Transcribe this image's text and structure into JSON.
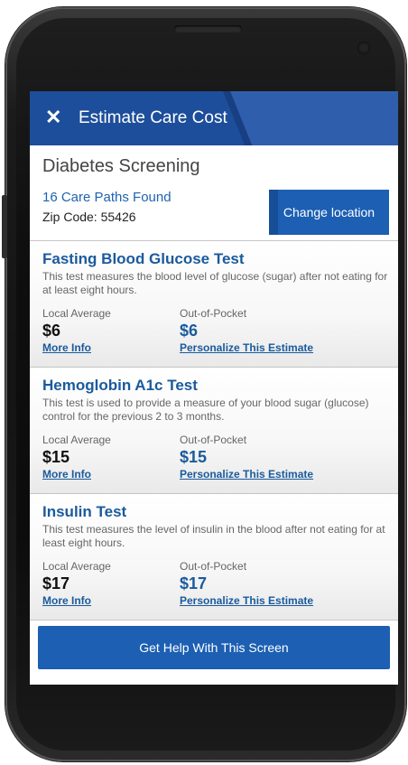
{
  "header": {
    "close_icon": "✕",
    "title": "Estimate Care Cost"
  },
  "page_title": "Diabetes Screening",
  "results": {
    "count_text": "16 Care Paths Found",
    "zip_text": "Zip Code: 55426",
    "change_location_label": "Change location"
  },
  "tests": [
    {
      "name": "Fasting Blood Glucose Test",
      "description": "This test measures the blood level of glucose (sugar) after not eating for at least eight hours.",
      "local_label": "Local Average",
      "local_value": "$6",
      "oop_label": "Out-of-Pocket",
      "oop_value": "$6",
      "more_info": "More Info",
      "personalize": "Personalize This Estimate"
    },
    {
      "name": "Hemoglobin A1c Test",
      "description": "This test is used to provide a measure of your blood sugar (glucose) control for the previous 2 to 3 months.",
      "local_label": "Local Average",
      "local_value": "$15",
      "oop_label": "Out-of-Pocket",
      "oop_value": "$15",
      "more_info": "More Info",
      "personalize": "Personalize This Estimate"
    },
    {
      "name": "Insulin Test",
      "description": "This test measures the level of insulin in the blood after not eating for at least eight hours.",
      "local_label": "Local Average",
      "local_value": "$17",
      "oop_label": "Out-of-Pocket",
      "oop_value": "$17",
      "more_info": "More Info",
      "personalize": "Personalize This Estimate"
    }
  ],
  "help_button": "Get Help With This Screen",
  "colors": {
    "brand_blue": "#1d4e9b",
    "button_blue": "#1c5fb3",
    "link_blue": "#1a5a9d"
  }
}
